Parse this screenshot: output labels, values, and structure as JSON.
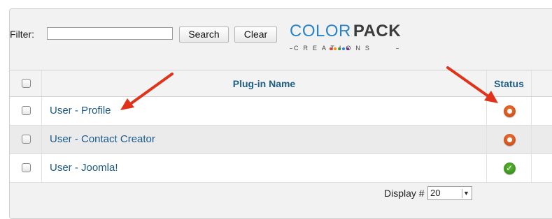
{
  "filter": {
    "label": "Filter:",
    "value": "",
    "search_button": "Search",
    "clear_button": "Clear"
  },
  "logo": {
    "word1": "COLOR",
    "word2": "PACK",
    "subtitle": "CREATIONS",
    "dot_colors": [
      "#e53935",
      "#fb8c00",
      "#43a047",
      "#1e88e5",
      "#8e24aa"
    ]
  },
  "table": {
    "columns": {
      "name": "Plug-in Name",
      "status": "Status"
    },
    "rows": [
      {
        "name": "User - Profile",
        "status": "disabled"
      },
      {
        "name": "User - Contact Creator",
        "status": "disabled"
      },
      {
        "name": "User - Joomla!",
        "status": "enabled"
      }
    ]
  },
  "footer": {
    "display_label": "Display #",
    "display_value": "20"
  },
  "colors": {
    "link": "#1a5a8a",
    "arrow": "#e0331a",
    "status_disabled": "#d9531e",
    "status_enabled": "#3f9f22"
  }
}
